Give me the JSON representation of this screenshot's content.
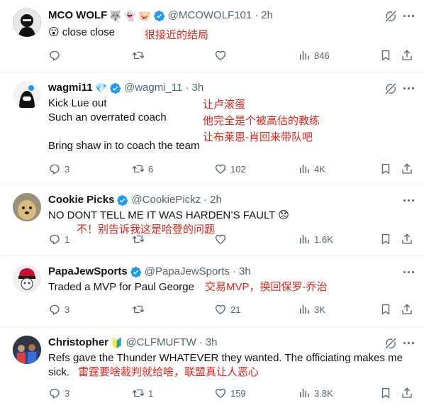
{
  "tweets": [
    {
      "name": "MCO WOLF",
      "badges": [
        "wolf-emoji",
        "ghost-emoji",
        "pig-emoji"
      ],
      "verified": true,
      "handle": "@MCOWOLF101",
      "time": "2h",
      "lines": [
        "😮 close close"
      ],
      "annotation": "很接近的结局",
      "replies": "",
      "retweets": "",
      "likes": "",
      "views": "846"
    },
    {
      "name": "wagmi11",
      "badges": [
        "gem-emoji"
      ],
      "verified": true,
      "handle": "@wagmi_11",
      "time": "3h",
      "lines": [
        "Kick Lue out",
        "Such an overrated coach",
        "",
        "Bring shaw in to coach the team"
      ],
      "annotation_lines": [
        "让卢滚蛋",
        "他完全是个被高估的教练",
        "让布莱恩-肖回来带队吧"
      ],
      "replies": "3",
      "retweets": "6",
      "likes": "102",
      "views": "4K"
    },
    {
      "name": "Cookie Picks",
      "badges": [],
      "verified": true,
      "handle": "@CookiePickz",
      "time": "2h",
      "lines": [
        "NO DONT TELL ME IT WAS HARDEN’S FAULT 😞"
      ],
      "annotation": "不！别告诉我这是哈登的问题",
      "replies": "1",
      "retweets": "",
      "likes": "",
      "views": "1.6K"
    },
    {
      "name": "PapaJewSports",
      "badges": [],
      "verified": true,
      "handle": "@PapaJewSports",
      "time": "3h",
      "lines": [
        "Traded a MVP for Paul George"
      ],
      "annotation": "交易MVP，换回保罗-乔治",
      "replies": "3",
      "retweets": "",
      "likes": "21",
      "views": "3K"
    },
    {
      "name": "Christopher",
      "badges": [
        "beginner-emoji"
      ],
      "verified": false,
      "handle": "@CLFMUFTW",
      "time": "3h",
      "lines": [
        "Refs gave the Thunder WHATEVER they wanted. The officiating makes me",
        "sick."
      ],
      "annotation": "雷霆要啥裁判就给啥，联盟真让人恶心",
      "replies": "3",
      "retweets": "1",
      "likes": "159",
      "views": "3.8K"
    }
  ],
  "colors": {
    "text": "#0f1419",
    "secondary": "#536471",
    "verified": "#1d9bf0",
    "annotation": "#e2231a"
  }
}
